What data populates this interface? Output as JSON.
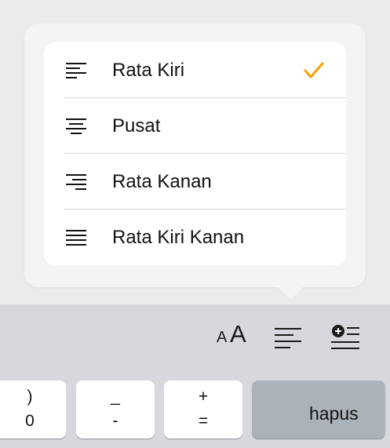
{
  "alignment_menu": {
    "items": [
      {
        "label": "Rata Kiri",
        "icon": "align-left-icon",
        "selected": true
      },
      {
        "label": "Pusat",
        "icon": "align-center-icon",
        "selected": false
      },
      {
        "label": "Rata Kanan",
        "icon": "align-right-icon",
        "selected": false
      },
      {
        "label": "Rata Kiri Kanan",
        "icon": "align-justify-icon",
        "selected": false
      }
    ],
    "check_color": "#f5a000"
  },
  "toolbar": {
    "font_size_small": "A",
    "font_size_large": "A",
    "align_icon": "align-left-icon",
    "insert_icon": "insert-add-icon"
  },
  "keyboard": {
    "keys": [
      {
        "top": ")",
        "bottom": "0"
      },
      {
        "top": "_",
        "bottom": "-"
      },
      {
        "top": "+",
        "bottom": "="
      }
    ],
    "delete_label": "hapus"
  }
}
